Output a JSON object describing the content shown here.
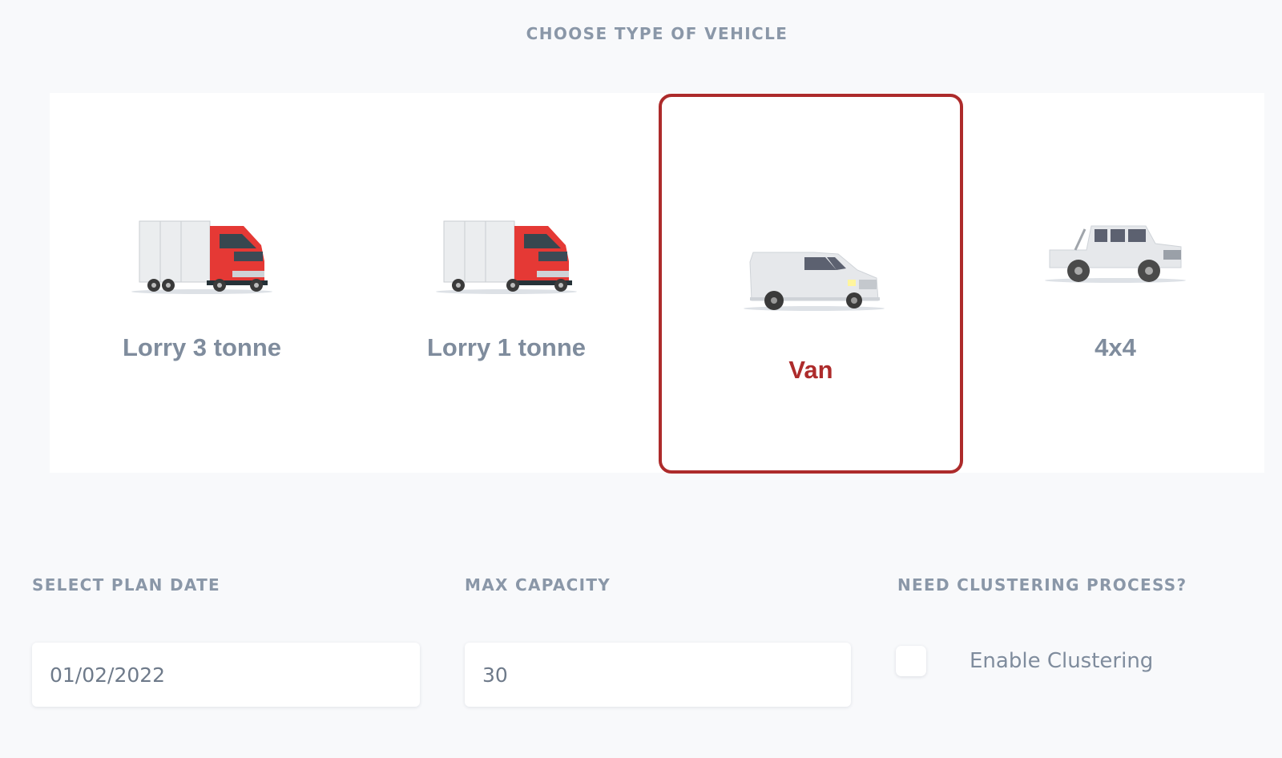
{
  "section_title": "CHOOSE TYPE OF VEHICLE",
  "vehicles": [
    {
      "label": "Lorry 3 tonne",
      "icon": "lorry-3-tonne-icon",
      "selected": false
    },
    {
      "label": "Lorry 1 tonne",
      "icon": "lorry-1-tonne-icon",
      "selected": false
    },
    {
      "label": "Van",
      "icon": "van-icon",
      "selected": true
    },
    {
      "label": "4x4",
      "icon": "4x4-icon",
      "selected": false
    }
  ],
  "plan_date": {
    "label": "SELECT PLAN DATE",
    "value": "01/02/2022"
  },
  "max_capacity": {
    "label": "MAX CAPACITY",
    "value": "30"
  },
  "clustering": {
    "label": "NEED CLUSTERING PROCESS?",
    "checkbox_label": "Enable Clustering",
    "checked": false
  },
  "colors": {
    "accent": "#ad2b2b",
    "muted_text": "#8a97a8",
    "background": "#f8f9fb",
    "truck_cab": "#e53935"
  }
}
